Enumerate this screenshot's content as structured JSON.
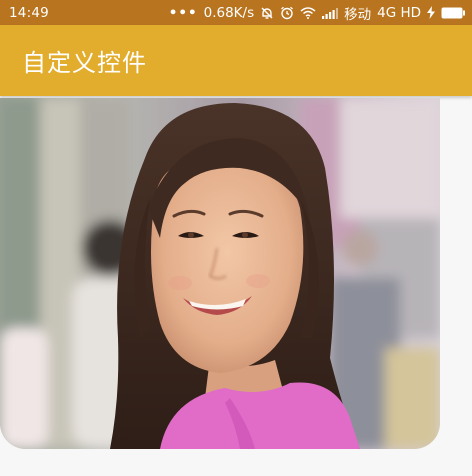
{
  "status_bar": {
    "time": "14:49",
    "dots": "•••",
    "speed": "0.68K/s",
    "carrier": "移动",
    "network": "4G HD",
    "icons": [
      "alarm-off-icon",
      "alarm-clock-icon",
      "wifi-icon",
      "signal-icon",
      "charging-icon",
      "battery-icon"
    ]
  },
  "app_bar": {
    "title": "自定义控件"
  },
  "content": {
    "image": "photo-of-smiling-woman-on-street",
    "colors": {
      "status_bar_bg": "#b8741f",
      "app_bar_bg": "#e2ac2c",
      "page_bg": "#f7f7f7"
    }
  }
}
